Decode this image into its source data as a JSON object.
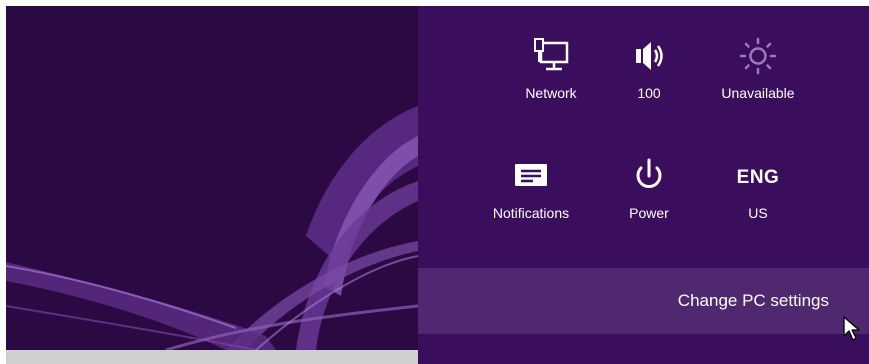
{
  "colors": {
    "panel_bg": "#3a0e5c",
    "desktop_bg": "#2b0a44",
    "change_settings_bg": "#4f2870",
    "text": "#ffffff"
  },
  "settings_charm": {
    "tiles": [
      {
        "id": "network",
        "icon": "network-icon",
        "label": "Network"
      },
      {
        "id": "volume",
        "icon": "speaker-icon",
        "label": "100"
      },
      {
        "id": "brightness",
        "icon": "brightness-icon",
        "label": "Unavailable"
      },
      {
        "id": "notifications",
        "icon": "notifications-icon",
        "label": "Notifications"
      },
      {
        "id": "power",
        "icon": "power-icon",
        "label": "Power"
      },
      {
        "id": "keyboard",
        "icon_text": "ENG",
        "label": "US"
      }
    ],
    "change_pc_settings": "Change PC settings"
  }
}
